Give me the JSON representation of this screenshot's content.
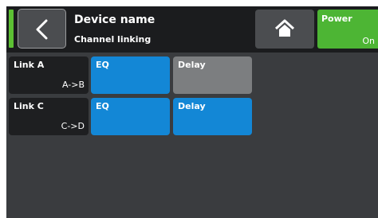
{
  "header": {
    "title": "Device name",
    "subtitle": "Channel linking",
    "power": {
      "label": "Power",
      "state": "On"
    }
  },
  "links": [
    {
      "label": "Link A",
      "route": "A->B",
      "eq_label": "EQ",
      "eq_state": "active",
      "delay_label": "Delay",
      "delay_state": "inactive"
    },
    {
      "label": "Link C",
      "route": "C->D",
      "eq_label": "EQ",
      "eq_state": "active",
      "delay_label": "Delay",
      "delay_state": "active"
    }
  ],
  "colors": {
    "active": "#1387d6",
    "inactive": "#7c7e80",
    "power": "#4db534"
  }
}
